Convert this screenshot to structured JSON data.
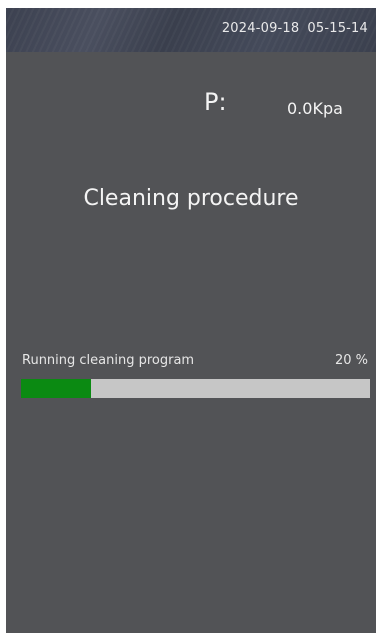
{
  "status_bar": {
    "date": "2024-09-18",
    "time": "05-15-14"
  },
  "pressure": {
    "label": "P:",
    "value": "0.0Kpa"
  },
  "procedure": {
    "title": "Cleaning procedure"
  },
  "progress": {
    "caption": "Running cleaning program",
    "percent_text": "20 %",
    "percent": 20
  },
  "colors": {
    "background": "#525356",
    "progress_fill": "#0b8a12",
    "progress_track": "#c6c6c6",
    "text": "#f4f4f4"
  }
}
